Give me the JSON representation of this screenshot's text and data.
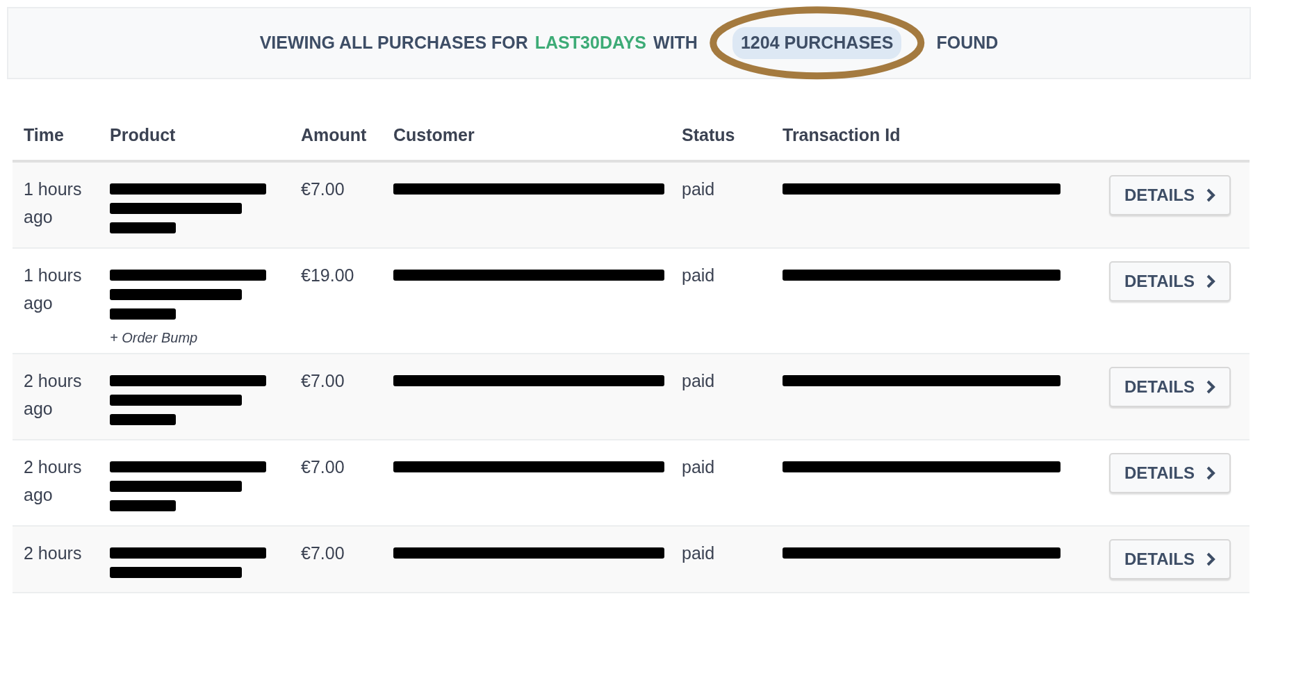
{
  "banner": {
    "parts": [
      {
        "kind": "text",
        "text": "VIEWING ALL PURCHASES FOR"
      },
      {
        "kind": "period",
        "text": "LAST30DAYS"
      },
      {
        "kind": "text",
        "text": "WITH"
      },
      {
        "kind": "count",
        "text": "1204 PURCHASES",
        "circled": true
      },
      {
        "kind": "text",
        "text": "FOUND"
      }
    ]
  },
  "table": {
    "columns": [
      "Time",
      "Product",
      "Amount",
      "Customer",
      "Status",
      "Transaction Id"
    ],
    "rows": [
      {
        "time": "1 hours ago",
        "product": [
          {
            "kind": "redaction"
          },
          {
            "kind": "redaction"
          },
          {
            "kind": "redaction"
          }
        ],
        "amount": "€7.00",
        "customer": [
          {
            "kind": "redaction"
          }
        ],
        "status": "paid",
        "transaction": [
          {
            "kind": "redaction"
          }
        ],
        "button": "DETAILS"
      },
      {
        "time": "1 hours ago",
        "product": [
          {
            "kind": "redaction"
          },
          {
            "kind": "redaction"
          },
          {
            "kind": "redaction"
          },
          {
            "kind": "note",
            "text": "+ Order Bump"
          }
        ],
        "amount": "€19.00",
        "customer": [
          {
            "kind": "redaction"
          }
        ],
        "status": "paid",
        "transaction": [
          {
            "kind": "redaction"
          }
        ],
        "button": "DETAILS"
      },
      {
        "time": "2 hours ago",
        "product": [
          {
            "kind": "redaction"
          },
          {
            "kind": "redaction"
          },
          {
            "kind": "redaction"
          }
        ],
        "amount": "€7.00",
        "customer": [
          {
            "kind": "redaction"
          }
        ],
        "status": "paid",
        "transaction": [
          {
            "kind": "redaction"
          }
        ],
        "button": "DETAILS"
      },
      {
        "time": "2 hours ago",
        "product": [
          {
            "kind": "redaction"
          },
          {
            "kind": "redaction"
          },
          {
            "kind": "redaction"
          }
        ],
        "amount": "€7.00",
        "customer": [
          {
            "kind": "redaction"
          }
        ],
        "status": "paid",
        "transaction": [
          {
            "kind": "redaction"
          }
        ],
        "button": "DETAILS"
      },
      {
        "time": "2 hours",
        "product": [
          {
            "kind": "redaction"
          },
          {
            "kind": "redaction"
          }
        ],
        "amount": "€7.00",
        "customer": [
          {
            "kind": "redaction"
          }
        ],
        "status": "paid",
        "transaction": [
          {
            "kind": "redaction"
          }
        ],
        "button": "DETAILS"
      }
    ]
  }
}
